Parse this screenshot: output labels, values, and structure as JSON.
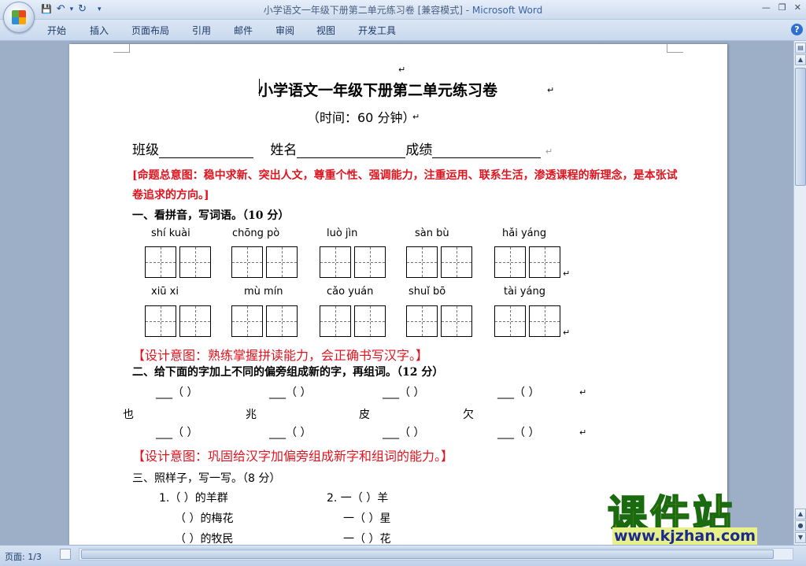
{
  "window": {
    "title_doc": "小学语文一年级下册第二单元练习卷 [兼容模式] - ",
    "title_app": "Microsoft Word"
  },
  "qat": {
    "save": "💾",
    "undo": "↶",
    "undo_drop": "▾",
    "redo": "↻",
    "customize": "▾"
  },
  "tabs": [
    "开始",
    "插入",
    "页面布局",
    "引用",
    "邮件",
    "审阅",
    "视图",
    "开发工具"
  ],
  "doc": {
    "pilcrow": "↵",
    "title": "小学语文一年级下册第二单元练习卷",
    "subtitle": "（时间：60 分钟）",
    "class_label": "班级",
    "name_label": "姓名",
    "score_label": "成绩",
    "intent_main": "[命题总意图：稳中求新、突出人文，尊重个性、强调能力，注重运用、联系生活，渗透课程的新理念，是本张试卷追求的方向。]",
    "sec1": "一、看拼音，写词语。（10 分）",
    "pinyin_row1": [
      "shí  kuài",
      "chōng  pò",
      "luò  jìn",
      "sàn  bù",
      "hǎi  yáng"
    ],
    "pinyin_row2": [
      "xiū  xi",
      "mù  mín",
      "cǎo  yuán",
      "shuǐ  bō",
      "tài  yáng"
    ],
    "intent1": "【设计意图：熟练掌握拼读能力，会正确书写汉字。】",
    "sec2": "二、给下面的字加上不同的偏旁组成新的字，再组词。（12 分）",
    "blank_item": "___（       ）",
    "chars": [
      "也",
      "兆",
      "皮",
      "欠"
    ],
    "intent2": "【设计意图：巩固给汉字加偏旁组成新字和组词的能力。】",
    "sec3": "三、照样子，写一写。（8 分）",
    "ex1": [
      "1.（          ）的羊群",
      "（          ）的梅花",
      "（          ）的牧民"
    ],
    "ex2": [
      "2. 一（        ）羊",
      "一（        ）星",
      "一（        ）花"
    ]
  },
  "status": {
    "page": "页面: 1/3"
  },
  "watermark": {
    "main": "课件站",
    "url": "www.kjzhan.com"
  },
  "colors": {
    "red_text": "#e0141e",
    "ribbon_bg": "#cddbee",
    "doc_bg": "#9daec7"
  }
}
